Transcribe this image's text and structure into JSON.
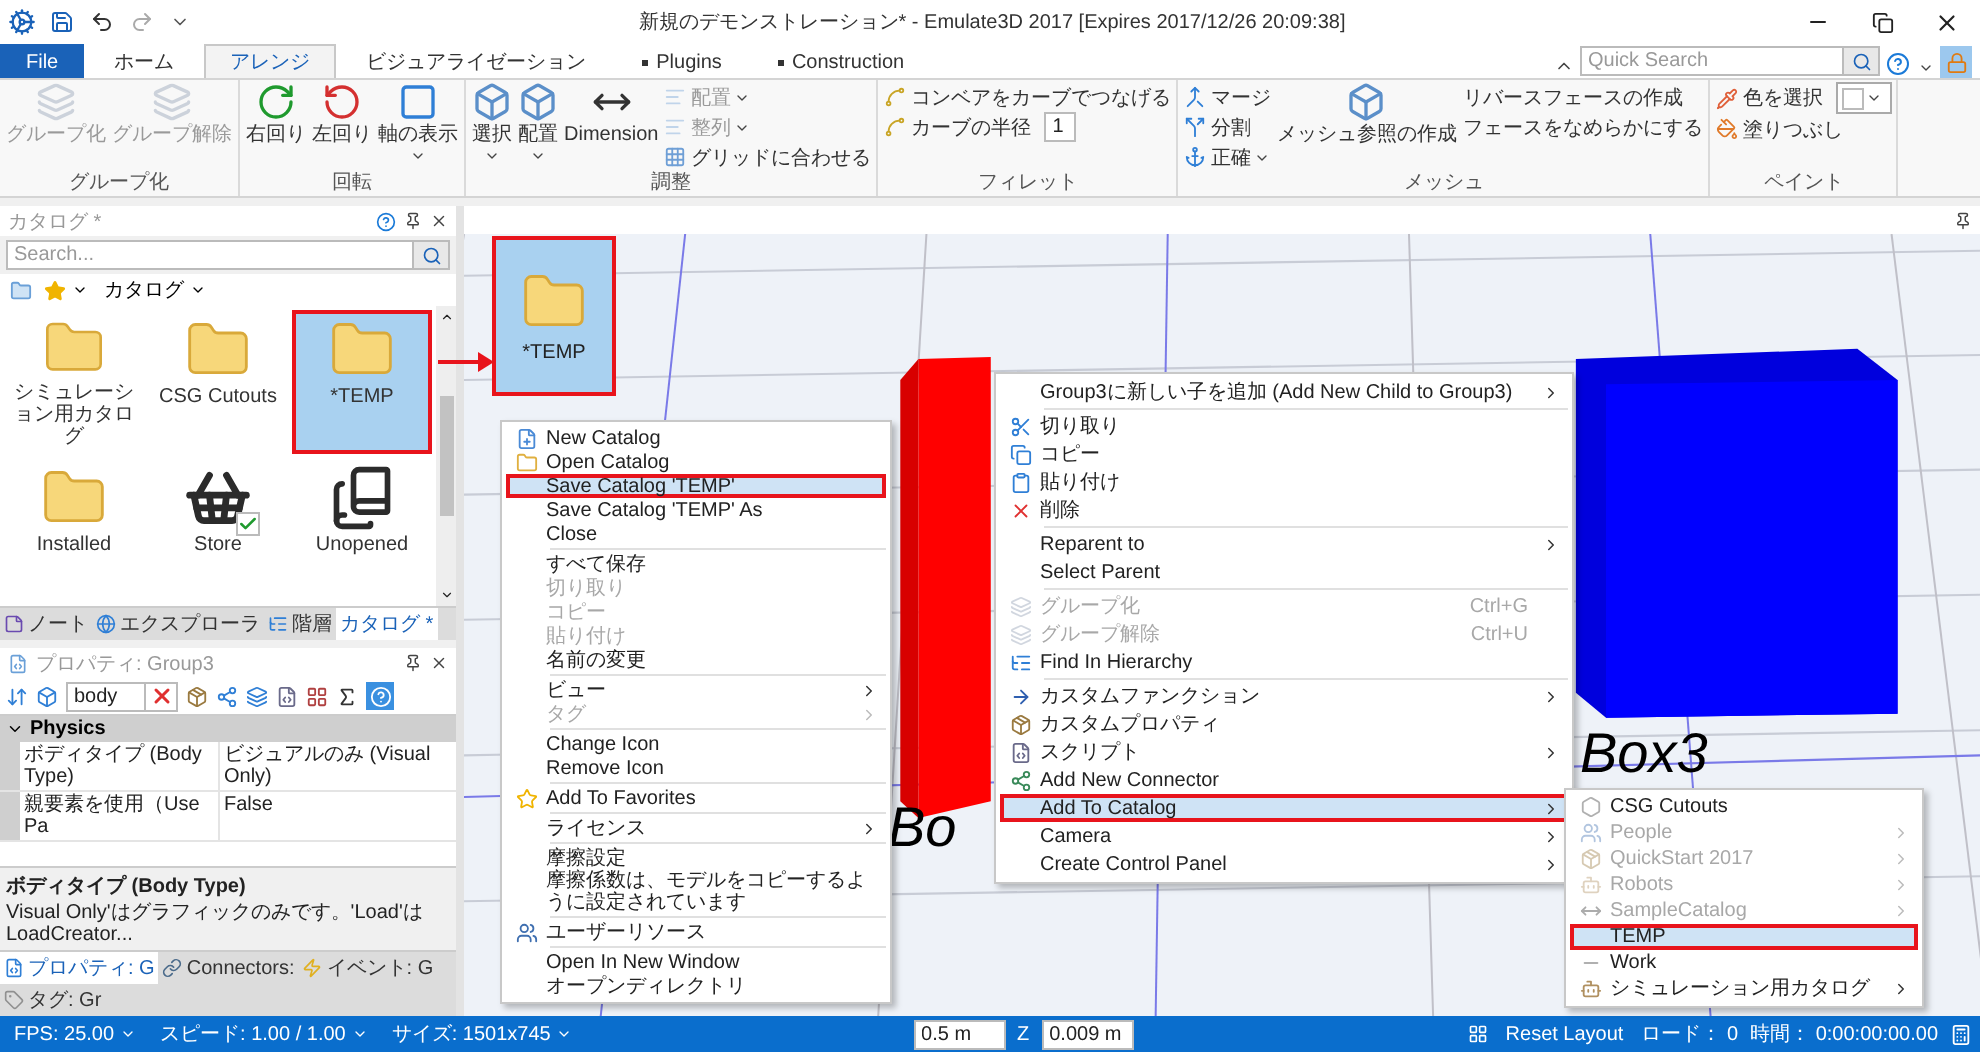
{
  "window": {
    "title": "新規のデモンストレーション* - Emulate3D 2017 [Expires 2017/12/26 20:09:38]"
  },
  "ribbon_tabs": [
    {
      "label": "File",
      "kind": "file",
      "selected": false
    },
    {
      "label": "ホーム",
      "kind": "tab",
      "selected": false
    },
    {
      "label": "アレンジ",
      "kind": "tab",
      "selected": true
    },
    {
      "label": "ビジュアライゼーション",
      "kind": "tab",
      "selected": false
    },
    {
      "label": "Plugins",
      "kind": "plugin",
      "selected": false
    },
    {
      "label": "Construction",
      "kind": "plugin",
      "selected": false
    }
  ],
  "quick_search": {
    "placeholder": "Quick Search"
  },
  "ribbon_groups": [
    {
      "title": "グループ化",
      "columns": [
        [
          {
            "kind": "large",
            "label": "グループ化",
            "disabled": true,
            "dropdown": false
          }
        ],
        [
          {
            "kind": "large",
            "label": "グループ解除",
            "disabled": true,
            "dropdown": false
          }
        ]
      ]
    },
    {
      "title": "回転",
      "columns": [
        [
          {
            "kind": "large",
            "label": "右回り",
            "disabled": false,
            "dropdown": false
          }
        ],
        [
          {
            "kind": "large",
            "label": "左回り",
            "disabled": false,
            "dropdown": false
          }
        ],
        [
          {
            "kind": "large",
            "label": "軸の表示",
            "disabled": false,
            "dropdown": true
          }
        ]
      ]
    },
    {
      "title": "調整",
      "columns": [
        [
          {
            "kind": "large",
            "label": "選択",
            "disabled": false,
            "dropdown": true
          }
        ],
        [
          {
            "kind": "large",
            "label": "配置",
            "disabled": false,
            "dropdown": true
          }
        ],
        [
          {
            "kind": "large",
            "label": "Dimension",
            "disabled": false,
            "dropdown": false
          }
        ],
        [
          {
            "kind": "small",
            "label": "配置",
            "disabled": true,
            "dropdown": true
          },
          {
            "kind": "small",
            "label": "整列",
            "disabled": true,
            "dropdown": true
          },
          {
            "kind": "small",
            "label": "グリッドに合わせる",
            "disabled": false,
            "dropdown": false
          }
        ]
      ]
    },
    {
      "title": "フィレット",
      "columns": [
        [
          {
            "kind": "small",
            "label": "コンベアをカーブでつなげる",
            "disabled": false,
            "dropdown": false
          },
          {
            "kind": "field",
            "label": "カーブの半径",
            "value": "1",
            "disabled": false
          }
        ]
      ]
    },
    {
      "title": "メッシュ",
      "columns": [
        [
          {
            "kind": "small",
            "label": "マージ",
            "disabled": false,
            "dropdown": false
          },
          {
            "kind": "small",
            "label": "分割",
            "disabled": false,
            "dropdown": false
          },
          {
            "kind": "small",
            "label": "正確",
            "disabled": false,
            "dropdown": true
          }
        ],
        [
          {
            "kind": "large",
            "label": "メッシュ参照の作成",
            "disabled": false,
            "dropdown": false
          }
        ],
        [
          {
            "kind": "small",
            "label": "リバースフェースの作成",
            "disabled": false,
            "dropdown": false
          },
          {
            "kind": "small",
            "label": "フェースをなめらかにする",
            "disabled": false,
            "dropdown": false
          }
        ]
      ]
    },
    {
      "title": "ペイント",
      "columns": [
        [
          {
            "kind": "color",
            "label": "色を選択",
            "disabled": false
          },
          {
            "kind": "small",
            "label": "塗りつぶし",
            "disabled": false,
            "dropdown": false
          }
        ]
      ]
    }
  ],
  "catalog": {
    "title": "カタログ *",
    "search": {
      "placeholder": "Search..."
    },
    "breadcrumb": "カタログ",
    "tiles": [
      {
        "label": "シミュレーション用カタログ",
        "selected": false,
        "outlined": false
      },
      {
        "label": "CSG Cutouts",
        "selected": false,
        "outlined": false
      },
      {
        "label": "*TEMP",
        "selected": true,
        "outlined": true
      },
      {
        "label": "Installed",
        "selected": false,
        "outlined": false
      },
      {
        "label": "Store",
        "selected": false,
        "outlined": false
      },
      {
        "label": "Unopened",
        "selected": false,
        "outlined": false
      }
    ]
  },
  "left_tabs": [
    {
      "label": "ノート",
      "selected": false
    },
    {
      "label": "エクスプローラ",
      "selected": false
    },
    {
      "label": "階層",
      "selected": false
    },
    {
      "label": "カタログ *",
      "selected": true
    }
  ],
  "properties": {
    "title": "プロパティ: Group3",
    "filter": "body",
    "category": "Physics",
    "expanded": true,
    "rows": [
      {
        "name": "ボディタイプ (Body Type)",
        "value": "ビジュアルのみ (Visual Only)"
      },
      {
        "name": "親要素を使用（Use Pa",
        "value": "False"
      }
    ],
    "description_title": "ボディタイプ (Body Type)",
    "description": "Visual Only'はグラフィックのみです。'Load'はLoadCreator..."
  },
  "bottom_tabs": [
    {
      "label": "プロパティ: G",
      "selected": true
    },
    {
      "label": "Connectors:",
      "selected": false
    },
    {
      "label": "イベント: G",
      "selected": false
    },
    {
      "label": "タグ: Gr",
      "selected": false
    }
  ],
  "viewport": {
    "labels": [
      "Bo",
      "Box3"
    ],
    "dragged_tile": {
      "label": "*TEMP",
      "outlined": true
    }
  },
  "catalog_menu": {
    "groups": [
      [
        {
          "label": "New Catalog",
          "disabled": false,
          "submenu": false,
          "selected": false,
          "outlined": false
        },
        {
          "label": "Open Catalog",
          "disabled": false,
          "submenu": false,
          "selected": false,
          "outlined": false
        },
        {
          "label": "Save Catalog 'TEMP'",
          "disabled": false,
          "submenu": false,
          "selected": true,
          "outlined": true
        },
        {
          "label": "Save Catalog 'TEMP' As",
          "disabled": false,
          "submenu": false,
          "selected": false,
          "outlined": false
        },
        {
          "label": "Close",
          "disabled": false,
          "submenu": false,
          "selected": false,
          "outlined": false
        }
      ],
      [
        {
          "label": "すべて保存",
          "disabled": false,
          "submenu": false,
          "selected": false,
          "outlined": false
        },
        {
          "label": "切り取り",
          "disabled": true,
          "submenu": false,
          "selected": false,
          "outlined": false
        },
        {
          "label": "コピー",
          "disabled": true,
          "submenu": false,
          "selected": false,
          "outlined": false
        },
        {
          "label": "貼り付け",
          "disabled": true,
          "submenu": false,
          "selected": false,
          "outlined": false
        },
        {
          "label": "名前の変更",
          "disabled": false,
          "submenu": false,
          "selected": false,
          "outlined": false
        }
      ],
      [
        {
          "label": "ビュー",
          "disabled": false,
          "submenu": true,
          "selected": false,
          "outlined": false
        },
        {
          "label": "タグ",
          "disabled": true,
          "submenu": true,
          "selected": false,
          "outlined": false
        }
      ],
      [
        {
          "label": "Change Icon",
          "disabled": false,
          "submenu": false,
          "selected": false,
          "outlined": false
        },
        {
          "label": "Remove Icon",
          "disabled": false,
          "submenu": false,
          "selected": false,
          "outlined": false
        }
      ],
      [
        {
          "label": "Add To Favorites",
          "disabled": false,
          "submenu": false,
          "selected": false,
          "outlined": false
        }
      ],
      [
        {
          "label": "ライセンス",
          "disabled": false,
          "submenu": true,
          "selected": false,
          "outlined": false
        }
      ],
      [
        {
          "label": "摩擦設定",
          "disabled": false,
          "submenu": false,
          "selected": false,
          "outlined": false
        },
        {
          "label": "摩擦係数は、モデルをコピーするように設定されています",
          "disabled": false,
          "submenu": false,
          "selected": false,
          "outlined": false
        }
      ],
      [
        {
          "label": "ユーザーリソース",
          "disabled": false,
          "submenu": false,
          "selected": false,
          "outlined": false
        }
      ],
      [
        {
          "label": "Open In New Window",
          "disabled": false,
          "submenu": false,
          "selected": false,
          "outlined": false
        },
        {
          "label": "オープンディレクトリ",
          "disabled": false,
          "submenu": false,
          "selected": false,
          "outlined": false
        }
      ]
    ]
  },
  "object_menu": {
    "groups": [
      [
        {
          "label": "Group3に新しい子を追加 (Add New Child to Group3)",
          "disabled": false,
          "submenu": true,
          "selected": false,
          "outlined": false
        }
      ],
      [
        {
          "label": "切り取り",
          "disabled": false,
          "submenu": false,
          "selected": false,
          "outlined": false
        },
        {
          "label": "コピー",
          "disabled": false,
          "submenu": false,
          "selected": false,
          "outlined": false
        },
        {
          "label": "貼り付け",
          "disabled": false,
          "submenu": false,
          "selected": false,
          "outlined": false
        },
        {
          "label": "削除",
          "disabled": false,
          "submenu": false,
          "selected": false,
          "outlined": false
        }
      ],
      [
        {
          "label": "Reparent to",
          "disabled": false,
          "submenu": true,
          "selected": false,
          "outlined": false
        },
        {
          "label": "Select Parent",
          "disabled": false,
          "submenu": false,
          "selected": false,
          "outlined": false
        }
      ],
      [
        {
          "label": "グループ化",
          "shortcut": "Ctrl+G",
          "disabled": true,
          "submenu": false,
          "selected": false,
          "outlined": false
        },
        {
          "label": "グループ解除",
          "shortcut": "Ctrl+U",
          "disabled": true,
          "submenu": false,
          "selected": false,
          "outlined": false
        },
        {
          "label": "Find In Hierarchy",
          "disabled": false,
          "submenu": false,
          "selected": false,
          "outlined": false
        }
      ],
      [
        {
          "label": "カスタムファンクション",
          "disabled": false,
          "submenu": true,
          "selected": false,
          "outlined": false
        },
        {
          "label": "カスタムプロパティ",
          "disabled": false,
          "submenu": false,
          "selected": false,
          "outlined": false
        },
        {
          "label": "スクリプト",
          "disabled": false,
          "submenu": true,
          "selected": false,
          "outlined": false
        },
        {
          "label": "Add New Connector",
          "disabled": false,
          "submenu": false,
          "selected": false,
          "outlined": false
        },
        {
          "label": "Add To Catalog",
          "disabled": false,
          "submenu": true,
          "selected": true,
          "outlined": true
        },
        {
          "label": "Camera",
          "disabled": false,
          "submenu": true,
          "selected": false,
          "outlined": false
        },
        {
          "label": "Create Control Panel",
          "disabled": false,
          "submenu": true,
          "selected": false,
          "outlined": false
        }
      ]
    ]
  },
  "catalog_submenu": {
    "groups": [
      [
        {
          "label": "CSG Cutouts",
          "disabled": false,
          "submenu": false,
          "selected": false,
          "outlined": false
        },
        {
          "label": "People",
          "disabled": true,
          "submenu": true,
          "selected": false,
          "outlined": false
        },
        {
          "label": "QuickStart 2017",
          "disabled": true,
          "submenu": true,
          "selected": false,
          "outlined": false
        },
        {
          "label": "Robots",
          "disabled": true,
          "submenu": true,
          "selected": false,
          "outlined": false
        },
        {
          "label": "SampleCatalog",
          "disabled": true,
          "submenu": true,
          "selected": false,
          "outlined": false
        },
        {
          "label": "TEMP",
          "disabled": false,
          "submenu": false,
          "selected": true,
          "outlined": true
        },
        {
          "label": "Work",
          "disabled": false,
          "submenu": false,
          "selected": false,
          "outlined": false
        },
        {
          "label": "シミュレーション用カタログ",
          "disabled": false,
          "submenu": true,
          "selected": false,
          "outlined": false
        }
      ]
    ]
  },
  "status_bar": {
    "readouts": [
      "FPS: 25.00",
      "スピード: 1.00 / 1.00",
      "サイズ: 1501x745"
    ],
    "coordinates": [
      {
        "value": "0.5 m"
      },
      {
        "axis": "Z",
        "value": "0.009 m"
      }
    ],
    "reset": "Reset Layout",
    "load": "ロード： 0",
    "time": "時間： 0:00:00:00.00"
  }
}
